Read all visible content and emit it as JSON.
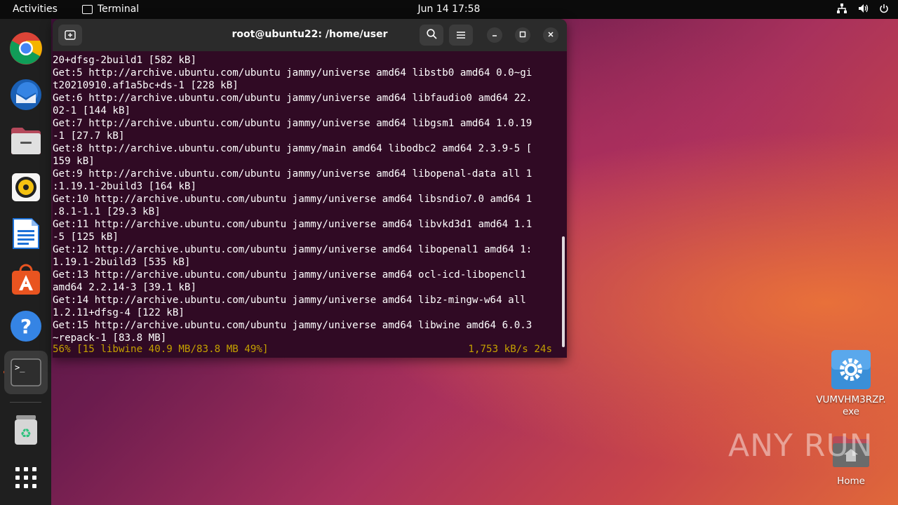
{
  "topbar": {
    "activities": "Activities",
    "app_name": "Terminal",
    "clock": "Jun 14  17:58"
  },
  "dock": {
    "items": [
      "chrome-icon",
      "thunderbird-icon",
      "files-icon",
      "rhythmbox-icon",
      "writer-icon",
      "software-icon",
      "help-icon",
      "terminal-icon",
      "trash-icon",
      "show-apps-icon"
    ]
  },
  "window": {
    "title": "root@ubuntu22: /home/user"
  },
  "terminal": {
    "lines": [
      "20+dfsg-2build1 [582 kB]",
      "Get:5 http://archive.ubuntu.com/ubuntu jammy/universe amd64 libstb0 amd64 0.0~gi",
      "t20210910.af1a5bc+ds-1 [228 kB]",
      "Get:6 http://archive.ubuntu.com/ubuntu jammy/universe amd64 libfaudio0 amd64 22.",
      "02-1 [144 kB]",
      "Get:7 http://archive.ubuntu.com/ubuntu jammy/universe amd64 libgsm1 amd64 1.0.19",
      "-1 [27.7 kB]",
      "Get:8 http://archive.ubuntu.com/ubuntu jammy/main amd64 libodbc2 amd64 2.3.9-5 [",
      "159 kB]",
      "Get:9 http://archive.ubuntu.com/ubuntu jammy/universe amd64 libopenal-data all 1",
      ":1.19.1-2build3 [164 kB]",
      "Get:10 http://archive.ubuntu.com/ubuntu jammy/universe amd64 libsndio7.0 amd64 1",
      ".8.1-1.1 [29.3 kB]",
      "Get:11 http://archive.ubuntu.com/ubuntu jammy/universe amd64 libvkd3d1 amd64 1.1",
      "-5 [125 kB]",
      "Get:12 http://archive.ubuntu.com/ubuntu jammy/universe amd64 libopenal1 amd64 1:",
      "1.19.1-2build3 [535 kB]",
      "Get:13 http://archive.ubuntu.com/ubuntu jammy/universe amd64 ocl-icd-libopencl1",
      "amd64 2.2.14-3 [39.1 kB]",
      "Get:14 http://archive.ubuntu.com/ubuntu jammy/universe amd64 libz-mingw-w64 all",
      "1.2.11+dfsg-4 [122 kB]",
      "Get:15 http://archive.ubuntu.com/ubuntu jammy/universe amd64 libwine amd64 6.0.3",
      "~repack-1 [83.8 MB]"
    ],
    "progress_left": "56% [15 libwine 40.9 MB/83.8 MB 49%]",
    "progress_right": "1,753 kB/s 24s"
  },
  "desktop": {
    "icons": [
      {
        "label_line1": "VUMVHM3RZP.",
        "label_line2": "exe"
      },
      {
        "label_line1": "Home",
        "label_line2": ""
      }
    ],
    "watermark": "ANY RUN"
  },
  "colors": {
    "terminal_bg": "#300a24",
    "progress_text": "#c4a000",
    "accent": "#e95420"
  }
}
